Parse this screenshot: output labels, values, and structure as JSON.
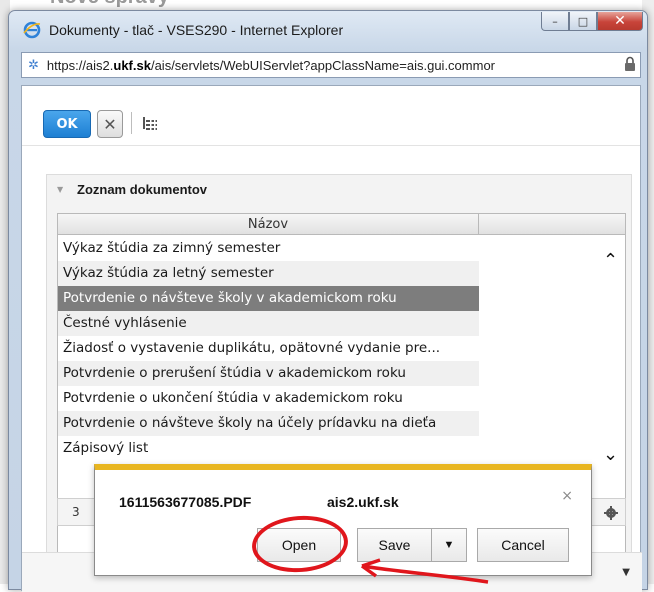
{
  "background": {
    "page_title": "Nové správy"
  },
  "window": {
    "title": "Dokumenty - tlač - VSES290 - Internet Explorer",
    "controls": {
      "minimize": "–",
      "maximize": "□",
      "close": "✕"
    }
  },
  "addressbar": {
    "url_prefix": "https://ais2.",
    "url_host": "ukf.sk",
    "url_rest": "/ais/servlets/WebUIServlet?appClassName=ais.gui.commor"
  },
  "toolbar": {
    "ok_label": "OK",
    "cancel_glyph": "✕"
  },
  "panel": {
    "title": "Zoznam dokumentov",
    "column_header": "Názov",
    "rows": [
      "Výkaz štúdia za zimný semester",
      "Výkaz štúdia za letný semester",
      "Potvrdenie o návšteve školy v akademickom roku",
      "Čestné vyhlásenie",
      "Žiadosť o vystavenie duplikátu, opätovné vydanie pre...",
      "Potvrdenie o prerušení štúdia v akademickom roku",
      "Potvrdenie o ukončení štúdia v akademickom roku",
      "Potvrdenie o návšteve školy na účely prídavku na dieťa",
      "Zápisový list"
    ],
    "selected_index": 2,
    "footer_count": "3"
  },
  "notification": {
    "filename": "1611563677085.PDF",
    "host": "ais2.ukf.sk",
    "open_label": "Open",
    "save_label": "Save",
    "cancel_label": "Cancel",
    "close_glyph": "×"
  },
  "colors": {
    "ok_button": "#1d7fd3",
    "selected_row": "#7d7d7d",
    "notification_accent": "#e8b520",
    "annotation_red": "#e0161c"
  }
}
